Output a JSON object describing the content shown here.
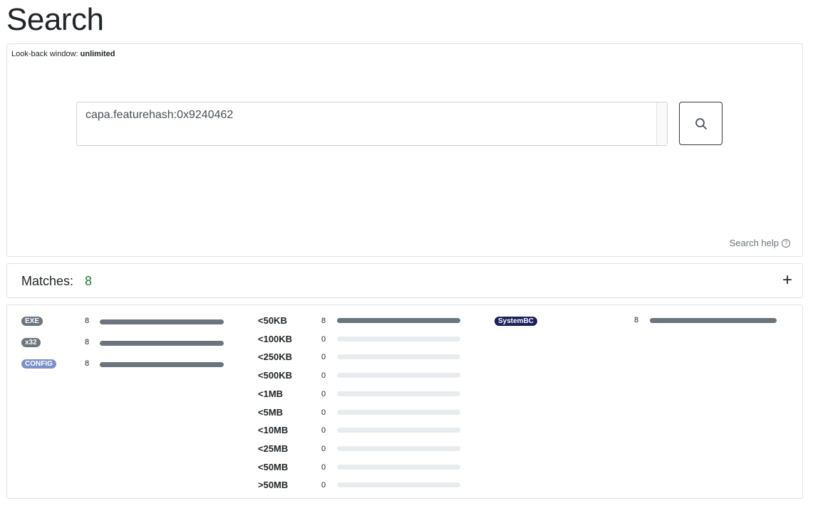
{
  "page": {
    "title": "Search"
  },
  "search": {
    "lookback_label": "Look-back window:",
    "lookback_value": "unlimited",
    "query": "capa.featurehash:0x9240462",
    "help_label": "Search help",
    "button_icon": "search-icon"
  },
  "matches": {
    "label": "Matches:",
    "count": "8",
    "expand_icon": "plus-icon",
    "expand_symbol": "+"
  },
  "facets": {
    "types": [
      {
        "label": "EXE",
        "count": "8",
        "fraction": 1.0,
        "color": "#6c757d"
      },
      {
        "label": "x32",
        "count": "8",
        "fraction": 1.0,
        "color": "#6c757d"
      },
      {
        "label": "CONFIG",
        "count": "8",
        "fraction": 1.0,
        "color": "#7b90c9"
      }
    ],
    "sizes": [
      {
        "label": "<50KB",
        "count": "8",
        "fraction": 1.0
      },
      {
        "label": "<100KB",
        "count": "0",
        "fraction": 0
      },
      {
        "label": "<250KB",
        "count": "0",
        "fraction": 0
      },
      {
        "label": "<500KB",
        "count": "0",
        "fraction": 0
      },
      {
        "label": "<1MB",
        "count": "0",
        "fraction": 0
      },
      {
        "label": "<5MB",
        "count": "0",
        "fraction": 0
      },
      {
        "label": "<10MB",
        "count": "0",
        "fraction": 0
      },
      {
        "label": "<25MB",
        "count": "0",
        "fraction": 0
      },
      {
        "label": "<50MB",
        "count": "0",
        "fraction": 0
      },
      {
        "label": ">50MB",
        "count": "0",
        "fraction": 0
      }
    ],
    "families": [
      {
        "label": "SystemBC",
        "count": "8",
        "fraction": 1.0,
        "color": "#1b1f5c"
      }
    ]
  }
}
